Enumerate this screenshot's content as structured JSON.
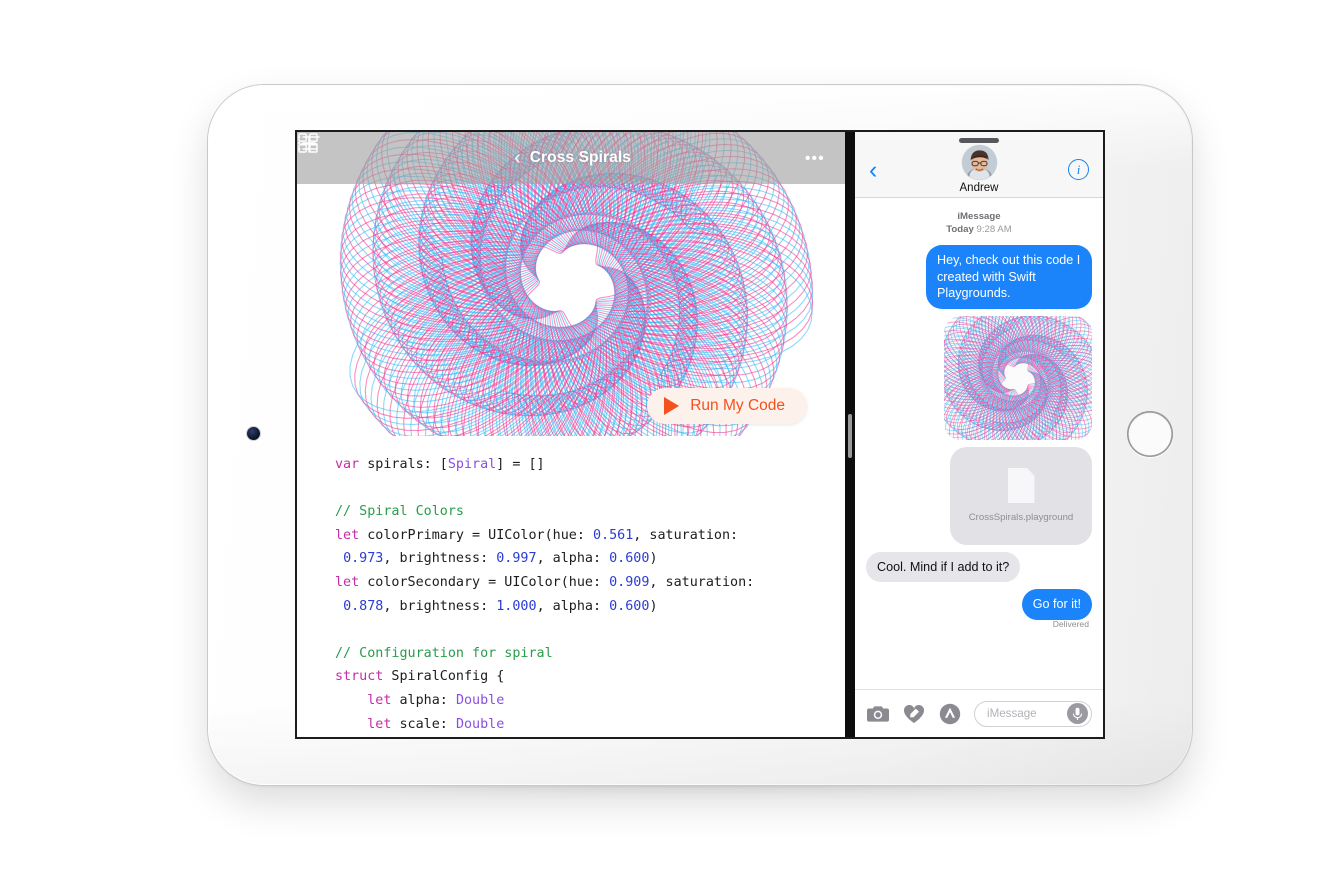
{
  "device": {
    "name": "ipad-silver"
  },
  "playgrounds": {
    "toolbar": {
      "grid_icon": "grid-icon",
      "list_icon": "list-icon",
      "back_chevron": "‹",
      "title": "Cross Spirals",
      "add_icon": "plus-icon",
      "more_icon": "•••"
    },
    "run_button": {
      "label": "Run My Code",
      "icon": "play-icon",
      "color": "#F4511E"
    },
    "code_lines": [
      [
        {
          "t": "var",
          "c": "kw"
        },
        {
          "t": " spirals: ["
        },
        {
          "t": "Spiral",
          "c": "type"
        },
        {
          "t": "] = []"
        }
      ],
      [
        {
          "t": ""
        }
      ],
      [
        {
          "t": "// Spiral Colors",
          "c": "cmt"
        }
      ],
      [
        {
          "t": "let",
          "c": "kw"
        },
        {
          "t": " colorPrimary = UIColor(hue: "
        },
        {
          "t": "0.561",
          "c": "num"
        },
        {
          "t": ", saturation:"
        }
      ],
      [
        {
          "t": " "
        },
        {
          "t": "0.973",
          "c": "num"
        },
        {
          "t": ", brightness: "
        },
        {
          "t": "0.997",
          "c": "num"
        },
        {
          "t": ", alpha: "
        },
        {
          "t": "0.600",
          "c": "num"
        },
        {
          "t": ")"
        }
      ],
      [
        {
          "t": "let",
          "c": "kw"
        },
        {
          "t": " colorSecondary = UIColor(hue: "
        },
        {
          "t": "0.909",
          "c": "num"
        },
        {
          "t": ", saturation:"
        }
      ],
      [
        {
          "t": " "
        },
        {
          "t": "0.878",
          "c": "num"
        },
        {
          "t": ", brightness: "
        },
        {
          "t": "1.000",
          "c": "num"
        },
        {
          "t": ", alpha: "
        },
        {
          "t": "0.600",
          "c": "num"
        },
        {
          "t": ")"
        }
      ],
      [
        {
          "t": ""
        }
      ],
      [
        {
          "t": "// Configuration for spiral",
          "c": "cmt"
        }
      ],
      [
        {
          "t": "struct",
          "c": "kw"
        },
        {
          "t": " SpiralConfig {"
        }
      ],
      [
        {
          "t": "    "
        },
        {
          "t": "let",
          "c": "kw"
        },
        {
          "t": " alpha: "
        },
        {
          "t": "Double",
          "c": "type"
        }
      ],
      [
        {
          "t": "    "
        },
        {
          "t": "let",
          "c": "kw"
        },
        {
          "t": " scale: "
        },
        {
          "t": "Double",
          "c": "type"
        }
      ]
    ],
    "spiral_colors": {
      "primary_blue": "#30B5F5",
      "secondary_pink": "#F0308C"
    }
  },
  "messages": {
    "header": {
      "back_chevron": "‹",
      "contact_name": "Andrew",
      "info_icon": "i",
      "avatar": "contact-photo"
    },
    "thread_meta": {
      "service": "iMessage",
      "day": "Today",
      "time": "9:28 AM"
    },
    "bubbles": [
      {
        "kind": "text",
        "side": "out",
        "text": "Hey, check out this code I created with Swift Playgrounds."
      },
      {
        "kind": "image",
        "side": "out",
        "alt": "cross-spirals-preview"
      },
      {
        "kind": "file",
        "side": "out",
        "filename": "CrossSpirals.playground"
      },
      {
        "kind": "text",
        "side": "in",
        "text": "Cool. Mind if I add to it?"
      },
      {
        "kind": "text",
        "side": "out",
        "text": "Go for it!"
      }
    ],
    "delivered_label": "Delivered",
    "toolbar": {
      "camera_icon": "camera-icon",
      "digital_touch_icon": "digital-touch-icon",
      "app_store_icon": "app-store-icon",
      "input_placeholder": "iMessage",
      "mic_icon": "microphone-icon"
    }
  }
}
